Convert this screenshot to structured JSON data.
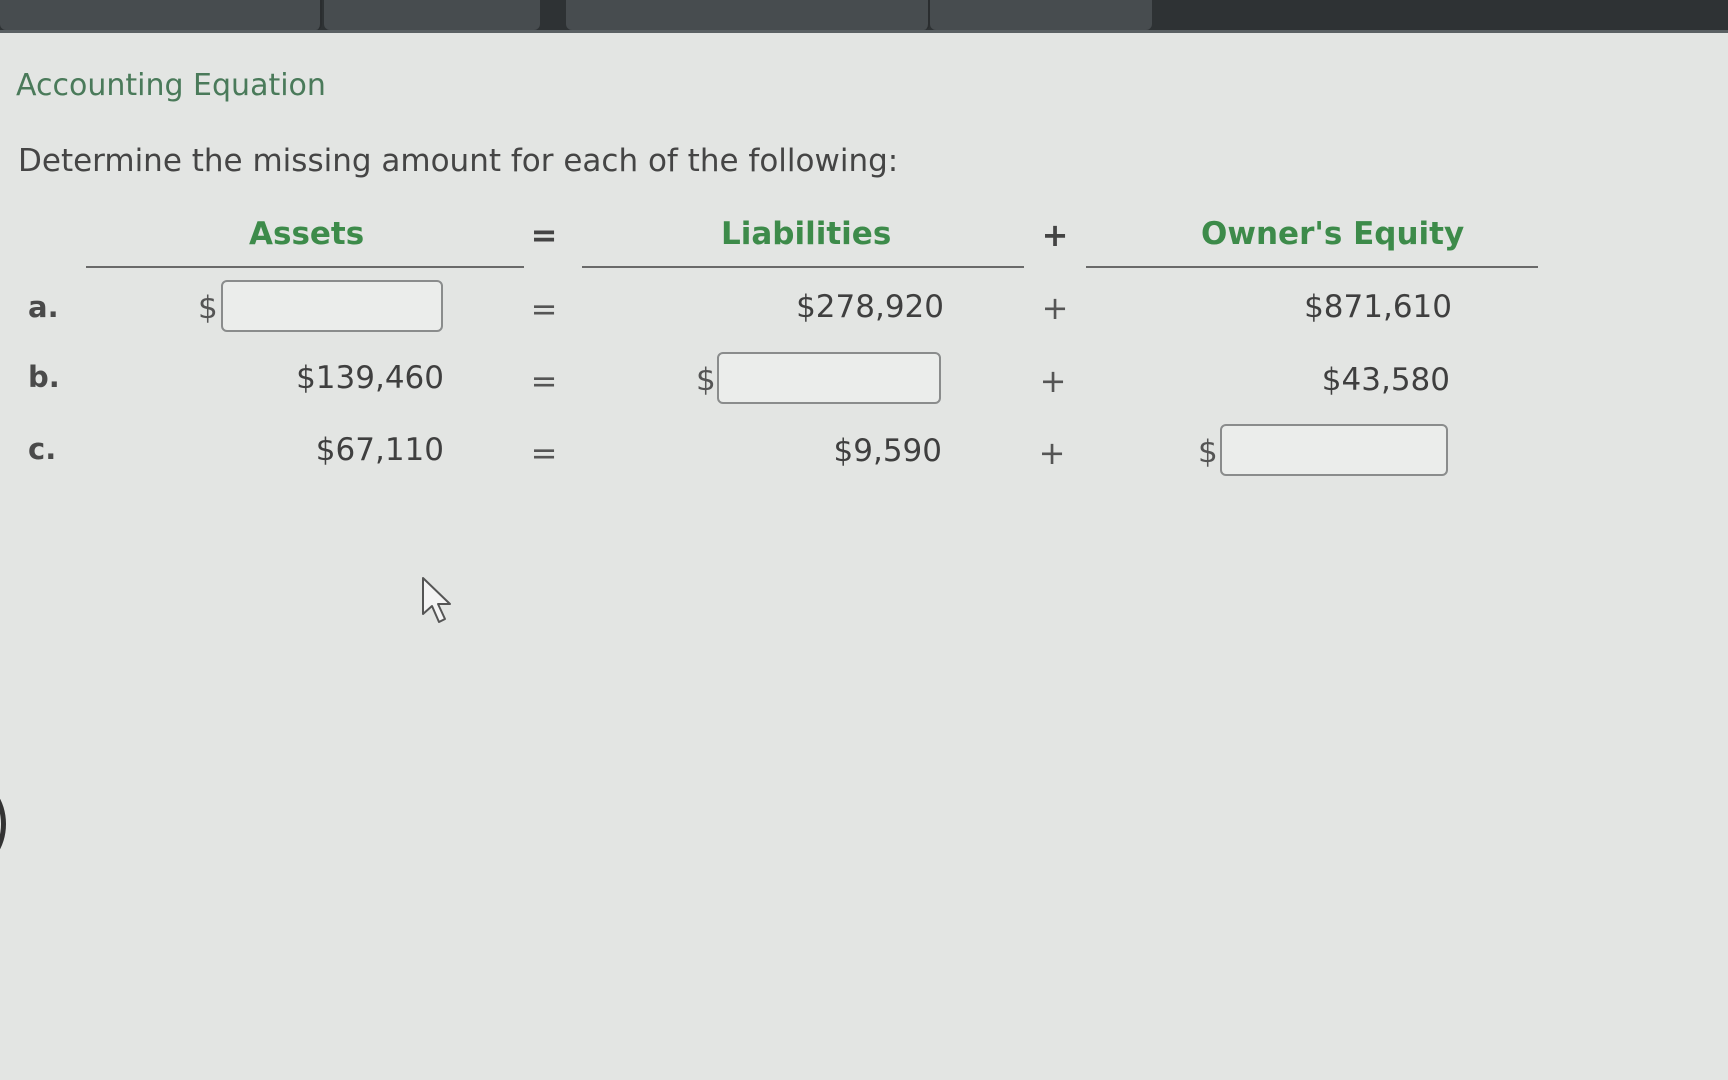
{
  "section_title": "Accounting Equation",
  "instruction": "Determine the missing amount for each of the following:",
  "columns": {
    "assets": "Assets",
    "liabilities": "Liabilities",
    "owners_equity": "Owner's Equity"
  },
  "operators": {
    "equals": "=",
    "plus": "+"
  },
  "currency_symbol": "$",
  "rows": [
    {
      "letter": "a.",
      "assets": "",
      "liabilities": "$278,920",
      "owners_equity": "$871,610",
      "missing": "assets"
    },
    {
      "letter": "b.",
      "assets": "$139,460",
      "liabilities": "",
      "owners_equity": "$43,580",
      "missing": "liabilities"
    },
    {
      "letter": "c.",
      "assets": "$67,110",
      "liabilities": "$9,590",
      "owners_equity": "",
      "missing": "owners_equity"
    }
  ],
  "colors": {
    "title": "#4a7a5a",
    "column_heading": "#3d8b4a",
    "background": "#e3e5e3",
    "top_bar": "#2e3234"
  }
}
